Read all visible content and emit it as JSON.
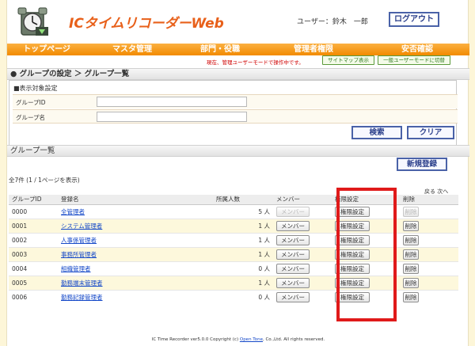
{
  "header": {
    "app_title": "ICタイムリコーダーWeb",
    "user_label": "ユーザー：鈴木　一郎",
    "logout_label": "ログアウト"
  },
  "nav": {
    "items": [
      {
        "label": "トップページ"
      },
      {
        "label": "マスタ管理"
      },
      {
        "label": "部門・役職"
      },
      {
        "label": "管理者権限"
      },
      {
        "label": "安否確認"
      }
    ]
  },
  "subbar": {
    "mode_text": "現在、管理ユーザーモードで操作中です。",
    "sitemap_label": "サイトマップ表示",
    "switch_label": "一般ユーザーモードに切替"
  },
  "page": {
    "title": "● グループの設定 ＞ グループ一覧"
  },
  "filter": {
    "subtitle": "■表示対象設定",
    "group_id_label": "グループID",
    "group_id_value": "",
    "group_name_label": "グループ名",
    "group_name_value": "",
    "search_label": "検索",
    "clear_label": "クリア"
  },
  "list": {
    "section_title": "グループ一覧",
    "new_label": "新規登録",
    "count_text": "全7件 (1 / 1ページを表示)",
    "pager_text": "戻る 次へ",
    "columns": {
      "group_id": "グループID",
      "name": "登録名",
      "members_count": "所属人数",
      "member": "メンバー",
      "permission": "権限設定",
      "delete": "削除"
    },
    "rows": [
      {
        "id": "0000",
        "name": "全管理者",
        "count": "5 人",
        "member": "メンバー",
        "perm": "権限設定",
        "del": "削除",
        "member_disabled": true,
        "del_disabled": true
      },
      {
        "id": "0001",
        "name": "システム管理者",
        "count": "1 人",
        "member": "メンバー",
        "perm": "権限設定",
        "del": "削除",
        "member_disabled": false,
        "del_disabled": false
      },
      {
        "id": "0002",
        "name": "人事係管理者",
        "count": "1 人",
        "member": "メンバー",
        "perm": "権限設定",
        "del": "削除",
        "member_disabled": false,
        "del_disabled": false
      },
      {
        "id": "0003",
        "name": "事務所管理者",
        "count": "1 人",
        "member": "メンバー",
        "perm": "権限設定",
        "del": "削除",
        "member_disabled": false,
        "del_disabled": false
      },
      {
        "id": "0004",
        "name": "組織管理者",
        "count": "0 人",
        "member": "メンバー",
        "perm": "権限設定",
        "del": "削除",
        "member_disabled": false,
        "del_disabled": false
      },
      {
        "id": "0005",
        "name": "勤務端末管理者",
        "count": "1 人",
        "member": "メンバー",
        "perm": "権限設定",
        "del": "削除",
        "member_disabled": false,
        "del_disabled": false
      },
      {
        "id": "0006",
        "name": "勤務記録管理者",
        "count": "0 人",
        "member": "メンバー",
        "perm": "権限設定",
        "del": "削除",
        "member_disabled": false,
        "del_disabled": false
      }
    ]
  },
  "footer": {
    "text_before": "IC Time Recorder ver5.0.0 Copyright (c) ",
    "link": "Open Tone",
    "text_after": ", Co.,Ltd. All rights reserved."
  },
  "colors": {
    "brand_orange": "#e8601a",
    "nav_orange": "#f28a00",
    "button_blue": "#4a62a8",
    "annotation_red": "#e01a1a"
  },
  "icons": [
    "clock-logo-icon"
  ]
}
